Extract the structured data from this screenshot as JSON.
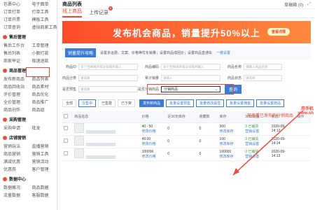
{
  "sidebar": {
    "top_rows": [
      [
        "包裹中心",
        "电子面单"
      ],
      [
        "订单打单",
        "打单工具"
      ],
      [
        "订单开票",
        "模板工具"
      ],
      [
        "订单查询",
        "虚拟商家工具"
      ]
    ],
    "sections": [
      {
        "title": "售后管理",
        "rows": [
          [
            "售后工作台",
            "工单管理"
          ],
          [
            "售后列表",
            "小额打款"
          ],
          [
            "商家举证",
            "极速退款"
          ]
        ]
      },
      {
        "title": "商品管理",
        "rows": [
          [
            "发布新商品",
            "商品列表"
          ],
          [
            "商品回收站",
            "商品素材"
          ],
          [
            "评价管理",
            "商品优化"
          ],
          [
            "全价管理",
            "商品推广"
          ],
          [
            "商品创作",
            "商品组"
          ]
        ]
      },
      {
        "title": "采购管理",
        "rows": [
          [
            "采购申请",
            "批发"
          ]
        ]
      },
      {
        "title": "店铺营销",
        "rows": [
          [
            "营销玩法",
            "直播营销"
          ],
          [
            "商品营销",
            "营销工具"
          ],
          [
            "满减优惠",
            "营销活动"
          ],
          [
            "优惠券",
            "客户管理"
          ]
        ]
      },
      {
        "title": "数据中心",
        "rows": [
          [
            "数据概况",
            "商品数据"
          ],
          [
            "流量数据",
            "客服数据"
          ]
        ]
      }
    ]
  },
  "header": {
    "title": "商品列表",
    "hint": "草稿箱",
    "count": "(0)",
    "tabs": [
      {
        "label": "线上商品"
      },
      {
        "label": "上传记录",
        "badge": "5"
      }
    ]
  },
  "banner": {
    "text": "发布机会商品，销量提升50%以上",
    "button": "查看详情"
  },
  "tipbar": {
    "label": "销量提升攻略",
    "text": "设置多运费、文案、价格等优化销量；设置商品成团价；设置商品直通车",
    "link": "一键设置"
  },
  "filters": {
    "id_label": "商品ID",
    "id_ph": "多个空格隔开或逗号隔开输入",
    "code_label": "商品编码",
    "code_ph": "多个空格隔开或逗号隔开输入",
    "name_label": "商品名称",
    "name_ph": "请输入商品名称",
    "cat_label": "商品分类",
    "cat_ph": "请选择",
    "stock_label": "累计销量",
    "stock_ph": "请输入",
    "status_label": "商品状态",
    "status_ph": "请选择",
    "pre_label": "是否预售",
    "pre_ph": "请选择",
    "dist_label": "是否分销商品",
    "dist_value": "分销商品",
    "query": "查询",
    "reset": "重置"
  },
  "annotation": {
    "text": "可查看已发布的分销商品",
    "watermark_top": "用手机",
    "watermark_bottom": "www.sh"
  },
  "actions": {
    "segments": [
      {
        "label": "全部",
        "on": false
      },
      {
        "label": "在售中",
        "on": true
      },
      {
        "label": "已售罄",
        "on": false
      },
      {
        "label": "已下架",
        "on": false
      }
    ],
    "buttons": [
      {
        "label": "发布新商品",
        "style": "primary"
      },
      {
        "label": "批量设置预售",
        "style": ""
      },
      {
        "label": "批量修改属性",
        "style": ""
      },
      {
        "label": "批量设置佣金",
        "style": ""
      },
      {
        "label": "批量设置赠品",
        "style": ""
      }
    ]
  },
  "table": {
    "columns": [
      "商品信息",
      "价格",
      "近30天库存",
      "收藏数",
      "库存",
      "30日销量",
      "状态",
      "操作"
    ],
    "rows": [
      {
        "price": "40 - 50",
        "price_link": "修改价格",
        "col3": "0",
        "fav": "0",
        "stock": "300",
        "stock_link": "修改库存",
        "sales": "0 已铺货",
        "sales_link": "营销设置",
        "status": "2020-09-",
        "time": "14:12"
      },
      {
        "price": "49.00",
        "price_link": "修改价格",
        "col3": "0",
        "fav": "0",
        "stock": "100",
        "stock_link": "修改库存",
        "sales": "0 已铺货",
        "sales_link": "营销设置",
        "status": "2020-09-",
        "time": "14:14"
      },
      {
        "price": "100000",
        "price_link": "修改价格",
        "col3": "0",
        "fav": "0",
        "stock": "100000",
        "stock_link": "修改库存",
        "sales": "0 已铺货",
        "sales_link": "营销设置",
        "status": "2020-09-",
        "time": "14:13"
      }
    ]
  }
}
